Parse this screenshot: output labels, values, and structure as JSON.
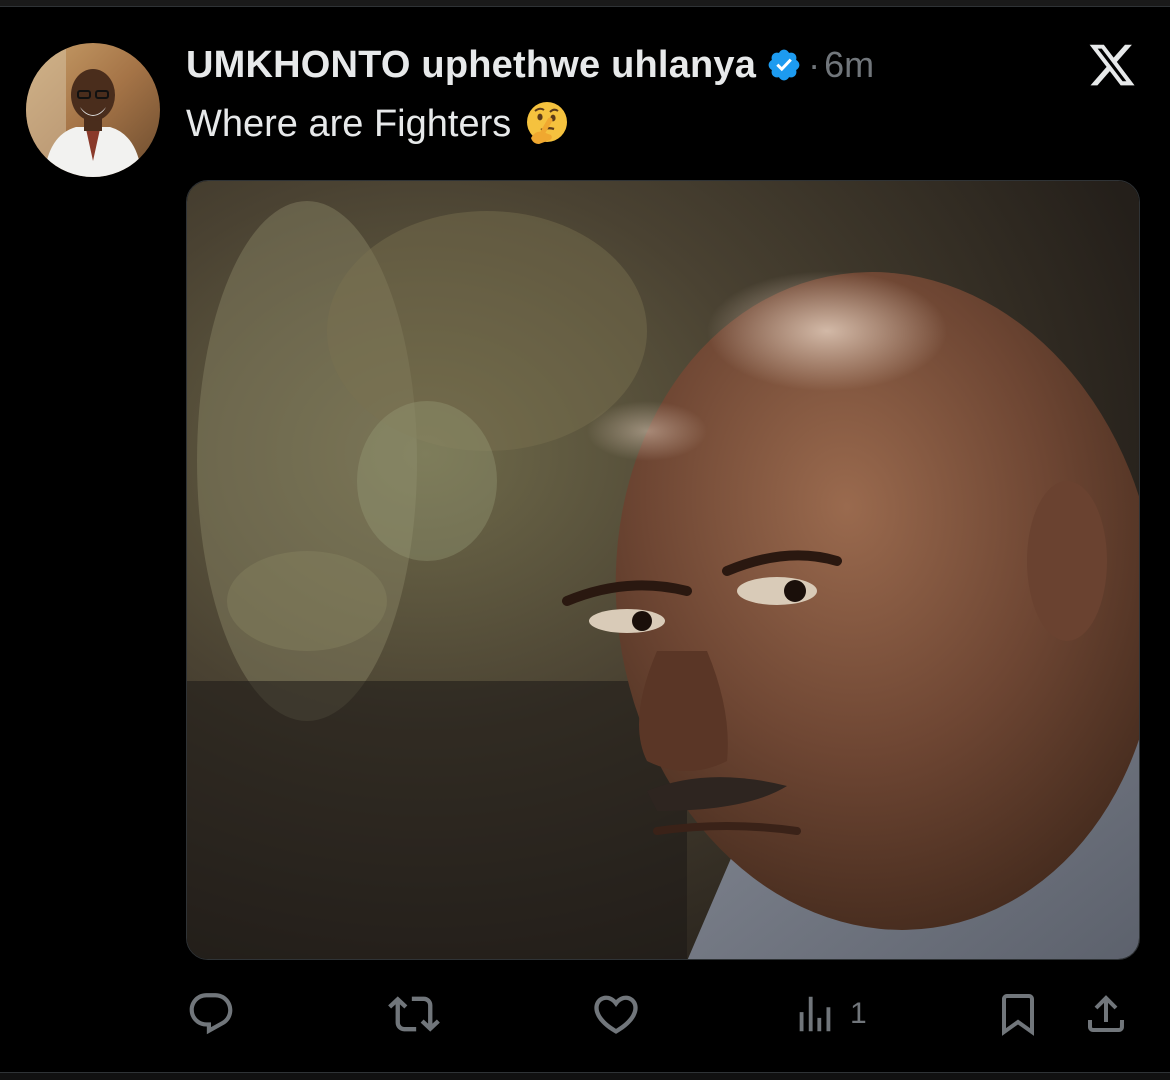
{
  "tweet": {
    "display_name": "UMKHONTO uphethwe uhlanya",
    "separator": "·",
    "timestamp": "6m",
    "text": "Where are Fighters",
    "emoji_name": "thinking-face",
    "verified": true,
    "platform_icon": "x-logo"
  },
  "actions": {
    "reply": {
      "icon": "reply-icon"
    },
    "retweet": {
      "icon": "retweet-icon"
    },
    "like": {
      "icon": "heart-icon"
    },
    "views": {
      "icon": "views-icon",
      "count": "1"
    },
    "bookmark": {
      "icon": "bookmark-icon"
    },
    "share": {
      "icon": "share-icon"
    }
  },
  "colors": {
    "background": "#000000",
    "text_primary": "#e7e9ea",
    "text_secondary": "#71767b",
    "verified_blue": "#1d9bf0"
  }
}
